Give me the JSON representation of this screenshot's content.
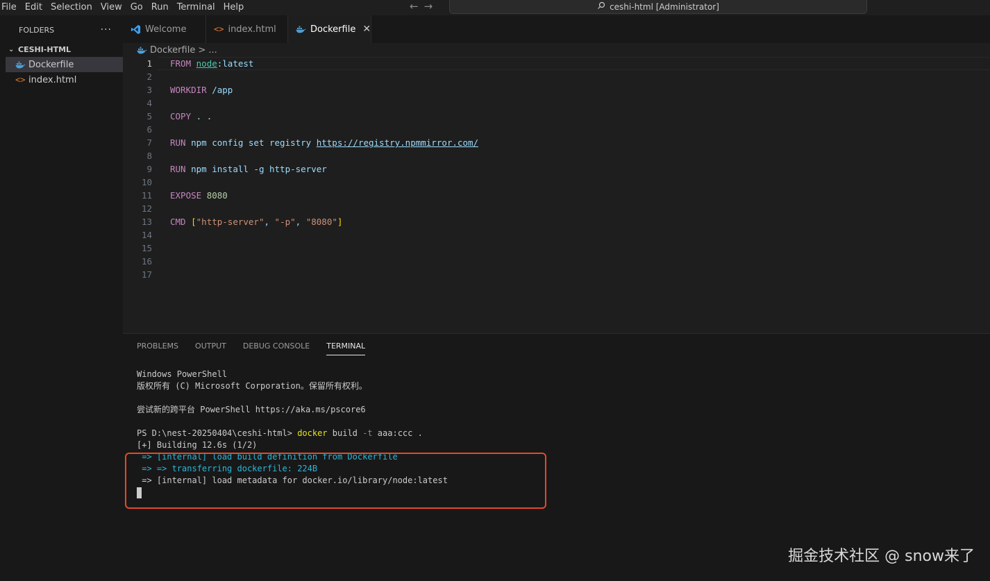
{
  "menu": [
    "File",
    "Edit",
    "Selection",
    "View",
    "Go",
    "Run",
    "Terminal",
    "Help"
  ],
  "command_center": "ceshi-html [Administrator]",
  "sidebar": {
    "header": "FOLDERS",
    "more": "···",
    "folder": "CESHI-HTML",
    "files": [
      {
        "name": "Dockerfile",
        "icon": "docker-icon"
      },
      {
        "name": "index.html",
        "icon": "html-icon"
      }
    ]
  },
  "tabs": [
    {
      "label": "Welcome",
      "icon": "vscode-icon"
    },
    {
      "label": "index.html",
      "icon": "html-icon"
    },
    {
      "label": "Dockerfile",
      "icon": "docker-icon",
      "close": "✕"
    }
  ],
  "breadcrumb": {
    "file": "Dockerfile",
    "rest": "> ..."
  },
  "editor": {
    "line_numbers": [
      "1",
      "2",
      "3",
      "4",
      "5",
      "6",
      "7",
      "8",
      "9",
      "10",
      "11",
      "12",
      "13",
      "14",
      "15",
      "16",
      "17"
    ],
    "lines": [
      {
        "kw": "FROM",
        "rest_a": "node",
        "rest_b": ":latest"
      },
      {},
      {
        "kw": "WORKDIR",
        "rest": "/app"
      },
      {},
      {
        "kw": "COPY",
        "rest": ". ."
      },
      {},
      {
        "kw": "RUN",
        "rest": "npm config set registry",
        "link": "https://registry.npmmirror.com/"
      },
      {},
      {
        "kw": "RUN",
        "rest": "npm install -g http-server"
      },
      {},
      {
        "kw": "EXPOSE",
        "num": "8080"
      },
      {},
      {
        "kw": "CMD",
        "s1": "\"http-server\"",
        "s2": "\"-p\"",
        "s3": "\"8080\""
      }
    ]
  },
  "panel": {
    "tabs": [
      "PROBLEMS",
      "OUTPUT",
      "DEBUG CONSOLE",
      "TERMINAL"
    ],
    "terminal": {
      "l1": "Windows PowerShell",
      "l2": "版权所有 (C) Microsoft Corporation。保留所有权利。",
      "l3": "尝试新的跨平台 PowerShell https://aka.ms/pscore6",
      "prompt": "PS D:\\nest-20250404\\ceshi-html> ",
      "cmd": "docker",
      "args_a": " build ",
      "flag": "-t",
      "args_b": " aaa:ccc .",
      "l5": "[+] Building 12.6s (1/2)",
      "l6": " => [internal] load build definition from Dockerfile",
      "l7": " => => transferring dockerfile: 224B",
      "l8": " => [internal] load metadata for docker.io/library/node:latest"
    }
  },
  "watermark": "掘金技术社区 @ snow来了"
}
